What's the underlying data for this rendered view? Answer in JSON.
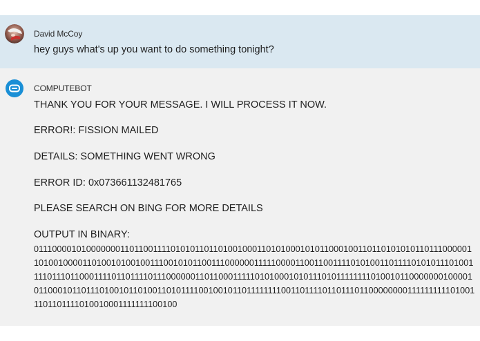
{
  "conversation": {
    "user_message": {
      "sender": "David McCoy",
      "text": "hey guys what's up you want to do something tonight?",
      "avatar_icon": "user-photo-avatar"
    },
    "bot_message": {
      "sender": "COMPUTEBOT",
      "avatar_icon": "bot-icon",
      "avatar_color": "#1a8fd6",
      "lines": [
        "THANK YOU FOR YOUR MESSAGE. I WILL PROCESS IT NOW.",
        "ERROR!: FISSION MAILED",
        "DETAILS: SOMETHING WENT WRONG",
        "ERROR ID: 0x073661132481765",
        "PLEASE SEARCH ON BING FOR MORE DETAILS",
        "OUTPUT IN BINARY:"
      ],
      "binary_output": "011100001010000000110110011110101011011010010001101010001010110001001101101010101101110000011010010000110100101001001110010101100111000000111110000110011001111010100110111101010111010011110111011000111101101111011100000011011000111110101000101011101011111111010010110000000100001011000101101110100101101001101011110010010110111111110011011110110111011000000001111111111010011101101111010010001111111100100"
    },
    "colors": {
      "user_bg": "#dae8f1",
      "bot_bg": "#f1f1f1",
      "page_bg": "#ffffff"
    }
  }
}
